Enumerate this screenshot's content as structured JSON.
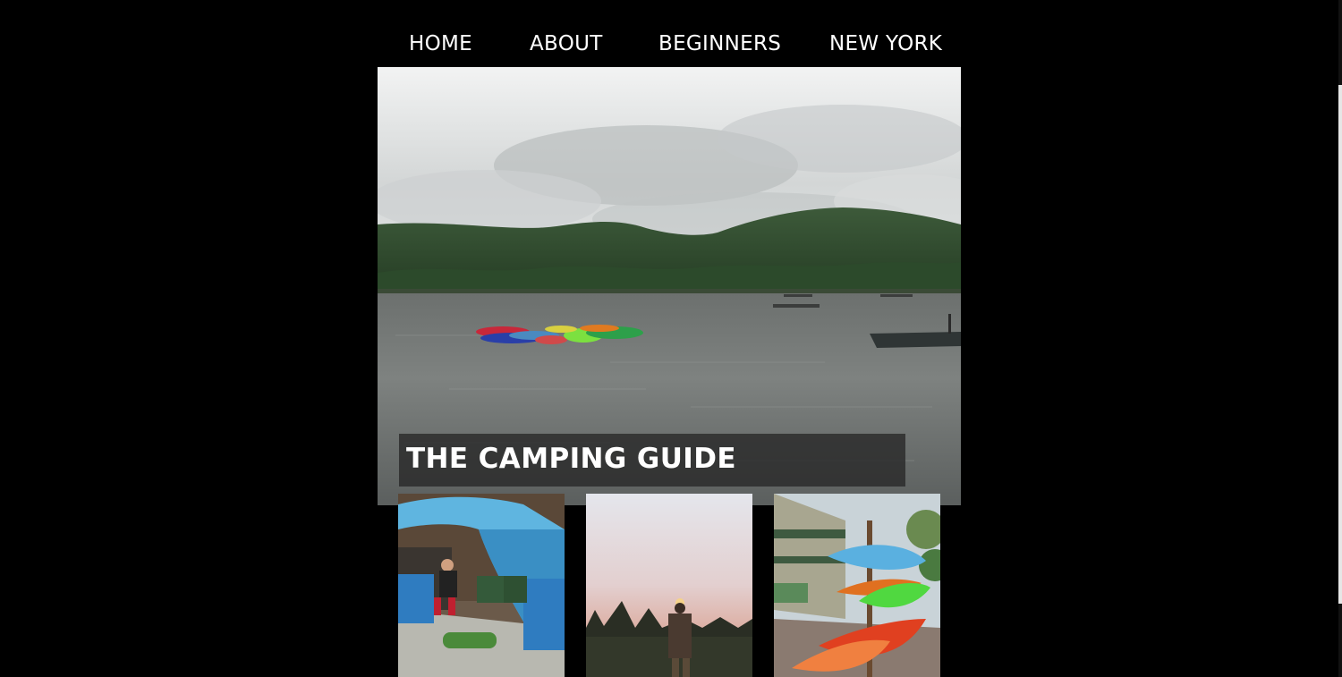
{
  "nav": {
    "items": [
      {
        "label": "HOME"
      },
      {
        "label": "ABOUT"
      },
      {
        "label": "BEGINNERS"
      },
      {
        "label": "NEW YORK"
      }
    ]
  },
  "hero": {
    "title": "THE CAMPING GUIDE",
    "image": "lake-with-kayaks-and-forested-hills"
  },
  "gallery": {
    "images": [
      {
        "subject": "person-sitting-in-blue-beach-tent"
      },
      {
        "subject": "person-watching-sunset-over-trees"
      },
      {
        "subject": "kayaks-on-rack-outside-store"
      }
    ]
  },
  "colors": {
    "background": "#000000",
    "nav_text": "#ffffff",
    "title_box": "#282828"
  }
}
